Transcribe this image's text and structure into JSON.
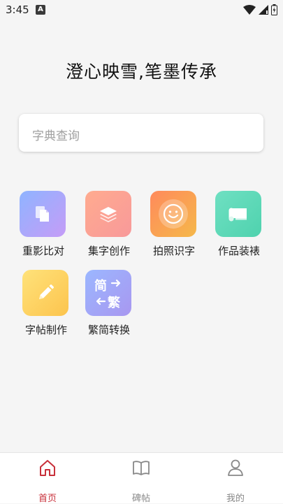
{
  "status": {
    "time": "3:45",
    "notification_badge": "A"
  },
  "header": {
    "slogan": "澄心映雪,笔墨传承"
  },
  "search": {
    "placeholder": "字典查询"
  },
  "tools": [
    {
      "label": "重影比对",
      "icon": "copy-icon",
      "gradient": [
        "#8fb4ff",
        "#c59cf7"
      ]
    },
    {
      "label": "集字创作",
      "icon": "layers-icon",
      "gradient": [
        "#ffab8f",
        "#f8999a"
      ]
    },
    {
      "label": "拍照识字",
      "icon": "smile-camera-icon",
      "gradient": [
        "#ff8a5c",
        "#f5b84a"
      ]
    },
    {
      "label": "作品装裱",
      "icon": "scroll-icon",
      "gradient": [
        "#6fe0c2",
        "#4fd2ae"
      ]
    },
    {
      "label": "字帖制作",
      "icon": "pencil-icon",
      "gradient": [
        "#ffe27a",
        "#fcc44e"
      ]
    },
    {
      "label": "繁简转换",
      "icon": "jian-fan-convert-icon",
      "gradient": [
        "#9bb7ff",
        "#a897f0"
      ],
      "glyph_top": "简",
      "glyph_bottom": "繁"
    }
  ],
  "nav": {
    "items": [
      {
        "label": "首页",
        "icon": "home-icon",
        "active": true
      },
      {
        "label": "碑帖",
        "icon": "book-icon",
        "active": false
      },
      {
        "label": "我的",
        "icon": "person-icon",
        "active": false
      }
    ]
  },
  "colors": {
    "accent": "#c8303a",
    "background": "#f5f5f5"
  }
}
